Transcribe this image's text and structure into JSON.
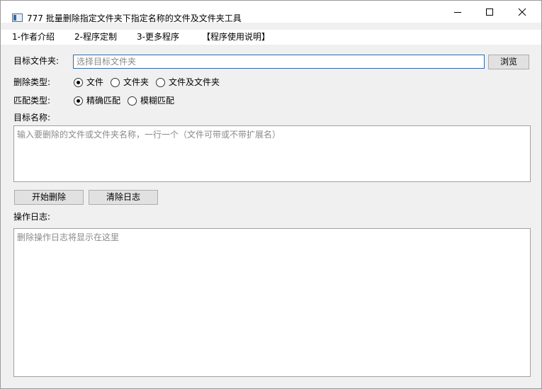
{
  "window": {
    "title": "777 批量删除指定文件夹下指定名称的文件及文件夹工具"
  },
  "menu": [
    {
      "label": "1-作者介绍"
    },
    {
      "label": "2-程序定制"
    },
    {
      "label": "3-更多程序"
    },
    {
      "label": "【程序使用说明】"
    }
  ],
  "target_folder": {
    "label": "目标文件夹:",
    "value": "",
    "placeholder": "选择目标文件夹",
    "browse_label": "浏览"
  },
  "delete_type": {
    "label": "删除类型:",
    "options": [
      {
        "label": "文件",
        "checked": true
      },
      {
        "label": "文件夹",
        "checked": false
      },
      {
        "label": "文件及文件夹",
        "checked": false
      }
    ]
  },
  "match_type": {
    "label": "匹配类型:",
    "options": [
      {
        "label": "精确匹配",
        "checked": true
      },
      {
        "label": "模糊匹配",
        "checked": false
      }
    ]
  },
  "target_names": {
    "label": "目标名称:",
    "placeholder": "输入要删除的文件或文件夹名称，一行一个（文件可带或不带扩展名）"
  },
  "actions": {
    "start_label": "开始删除",
    "clear_label": "清除日志"
  },
  "log": {
    "label": "操作日志:",
    "placeholder": "删除操作日志将显示在这里"
  },
  "icons": {
    "app": "app-window-icon",
    "minimize": "minimize-icon",
    "maximize": "maximize-icon",
    "close": "close-icon"
  }
}
